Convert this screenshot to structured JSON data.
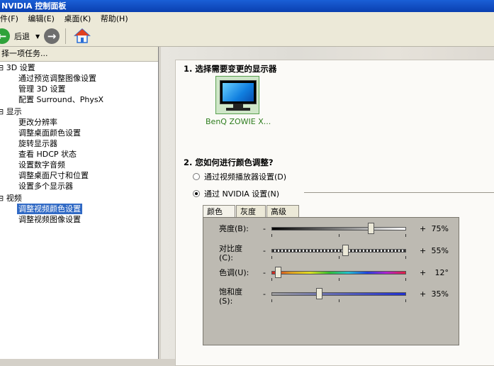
{
  "window": {
    "title": "NVIDIA 控制面板"
  },
  "menu": [
    "件(F)",
    "编辑(E)",
    "桌面(K)",
    "帮助(H)"
  ],
  "toolbar": {
    "back_label": "后退",
    "forward_icon": "forward-arrow-icon",
    "home_icon": "home-icon"
  },
  "tasks_header": "择一项任务...",
  "tree": [
    {
      "label": "3D 设置",
      "level": 0,
      "type": "category"
    },
    {
      "label": "通过预览调整图像设置",
      "level": 1
    },
    {
      "label": "管理 3D 设置",
      "level": 1
    },
    {
      "label": "配置 Surround、PhysX",
      "level": 1
    },
    {
      "label": "显示",
      "level": 0,
      "type": "category"
    },
    {
      "label": "更改分辨率",
      "level": 1
    },
    {
      "label": "调整桌面颜色设置",
      "level": 1
    },
    {
      "label": "旋转显示器",
      "level": 1
    },
    {
      "label": "查看 HDCP 状态",
      "level": 1
    },
    {
      "label": "设置数字音频",
      "level": 1
    },
    {
      "label": "调整桌面尺寸和位置",
      "level": 1
    },
    {
      "label": "设置多个显示器",
      "level": 1
    },
    {
      "label": "视频",
      "level": 0,
      "type": "category"
    },
    {
      "label": "调整视频颜色设置",
      "level": 1,
      "selected": true
    },
    {
      "label": "调整视频图像设置",
      "level": 1
    }
  ],
  "section1": {
    "title": "1. 选择需要变更的显示器",
    "display_name": "BenQ ZOWIE X..."
  },
  "section2": {
    "title": "2. 您如何进行颜色调整?",
    "options": [
      {
        "label": "通过视频播放器设置(D)",
        "checked": false
      },
      {
        "label": "通过 NVIDIA 设置(N)",
        "checked": true
      }
    ]
  },
  "tabs": [
    {
      "label": "颜色",
      "active": true
    },
    {
      "label": "灰度",
      "active": false
    },
    {
      "label": "高级",
      "active": false
    }
  ],
  "sliders": [
    {
      "label": "亮度(B):",
      "minus": "-",
      "plus": "+",
      "value_text": "75%",
      "value": 0.75,
      "track": "grayscale"
    },
    {
      "label": "对比度\n(C):",
      "minus": "-",
      "plus": "+",
      "value_text": "55%",
      "value": 0.55,
      "track": "dashed"
    },
    {
      "label": "色调(U):",
      "minus": "-",
      "plus": "+",
      "value_text": "12°",
      "value": 0.03,
      "track": "hue"
    },
    {
      "label": "饱和度\n(S):",
      "minus": "-",
      "plus": "+",
      "value_text": "35%",
      "value": 0.35,
      "track": "saturation"
    }
  ]
}
